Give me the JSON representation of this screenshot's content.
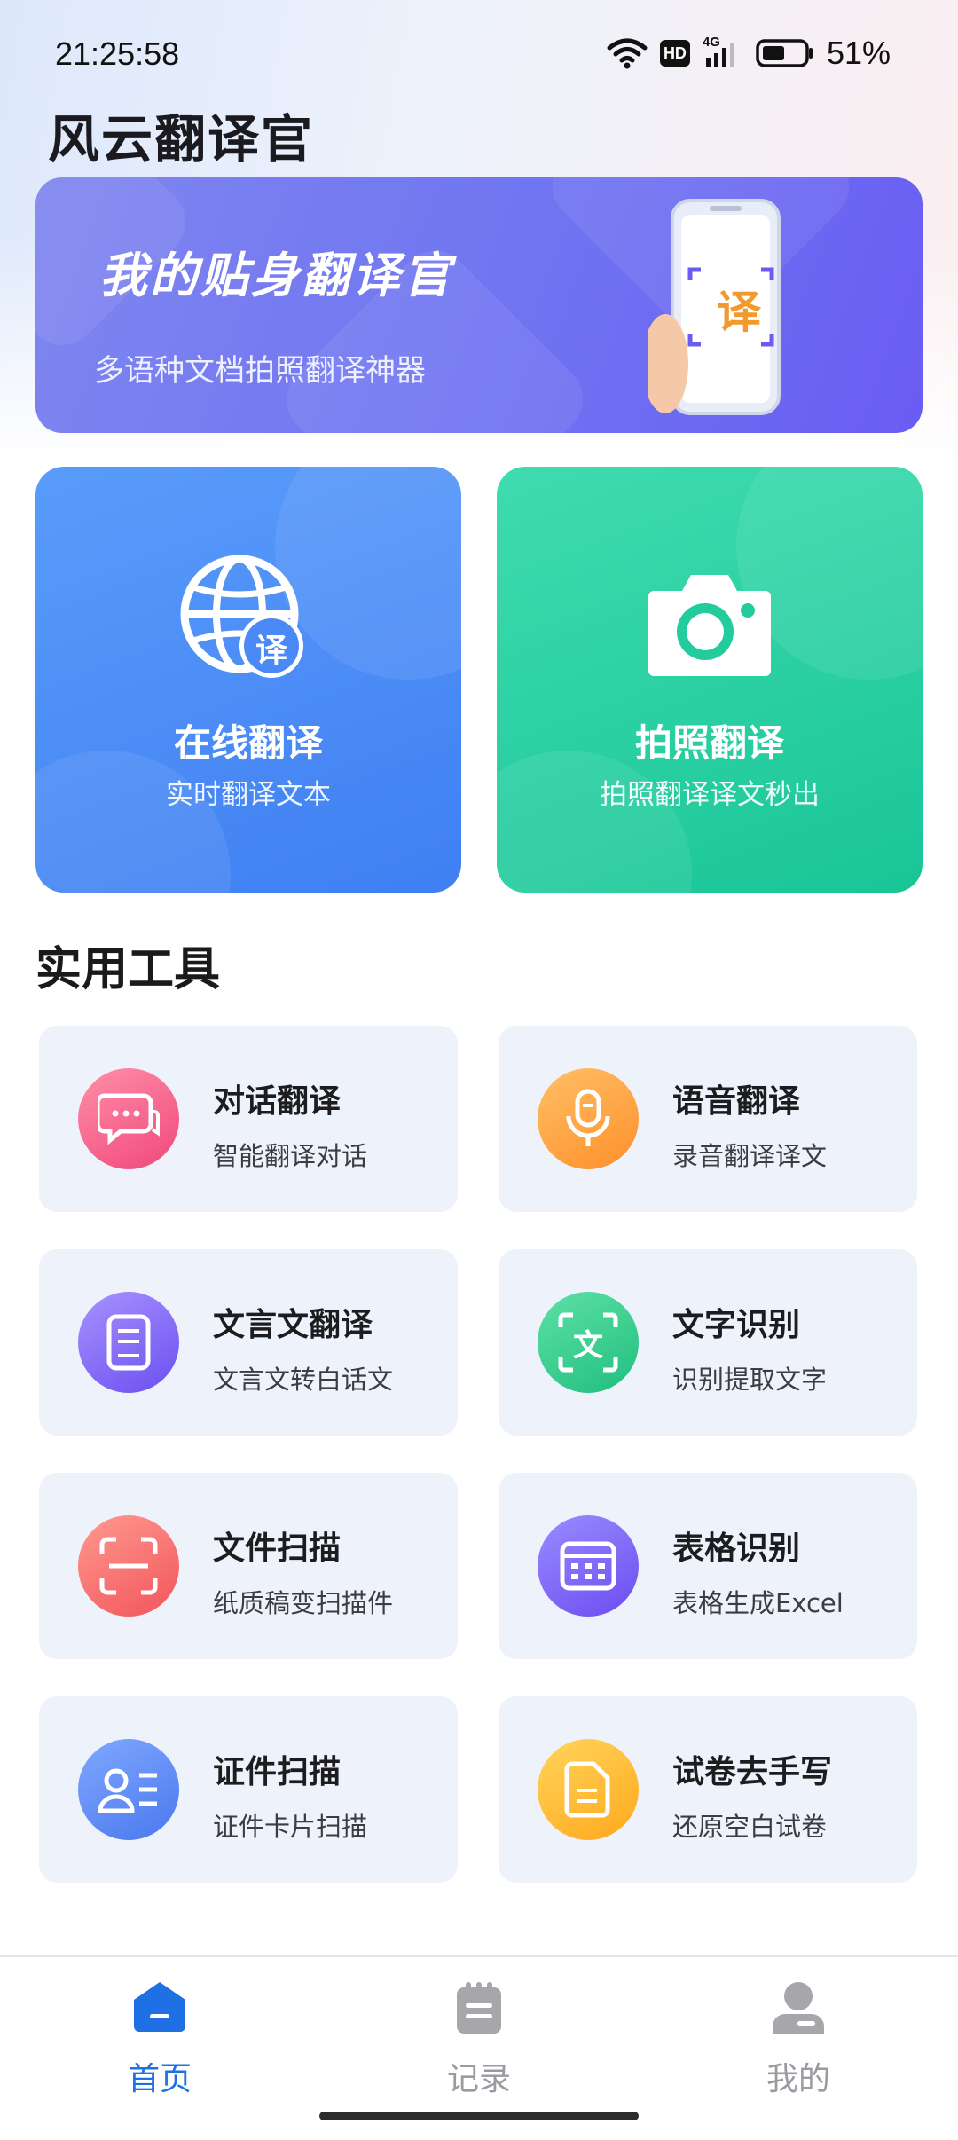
{
  "status_bar": {
    "time": "21:25:58",
    "network": "4G",
    "hd_label": "HD",
    "battery": "51%"
  },
  "app": {
    "title": "风云翻译官"
  },
  "banner": {
    "title": "我的贴身翻译官",
    "subtitle": "多语种文档拍照翻译神器",
    "phone_glyph": "译"
  },
  "feature_cards": [
    {
      "title": "在线翻译",
      "subtitle": "实时翻译文本",
      "icon": "globe-translate-icon",
      "badge": "译",
      "color": "#4a89f6"
    },
    {
      "title": "拍照翻译",
      "subtitle": "拍照翻译译文秒出",
      "icon": "camera-icon",
      "color": "#22cc9c"
    }
  ],
  "tools_section": {
    "title": "实用工具",
    "items": [
      {
        "name": "对话翻译",
        "desc": "智能翻译对话",
        "icon": "chat-bubble-icon"
      },
      {
        "name": "语音翻译",
        "desc": "录音翻译译文",
        "icon": "microphone-icon"
      },
      {
        "name": "文言文翻译",
        "desc": "文言文转白话文",
        "icon": "book-icon"
      },
      {
        "name": "文字识别",
        "desc": "识别提取文字",
        "icon": "text-scan-icon",
        "glyph": "文"
      },
      {
        "name": "文件扫描",
        "desc": "纸质稿变扫描件",
        "icon": "document-scan-icon"
      },
      {
        "name": "表格识别",
        "desc": "表格生成Excel",
        "icon": "table-icon"
      },
      {
        "name": "证件扫描",
        "desc": "证件卡片扫描",
        "icon": "id-card-icon"
      },
      {
        "name": "试卷去手写",
        "desc": "还原空白试卷",
        "icon": "exam-paper-icon"
      }
    ]
  },
  "tabbar": {
    "active_color": "#1f6fe5",
    "inactive_color": "#9a9aa0",
    "tabs": [
      {
        "label": "首页",
        "icon": "home-icon",
        "active": true
      },
      {
        "label": "记录",
        "icon": "notepad-icon",
        "active": false
      },
      {
        "label": "我的",
        "icon": "user-icon",
        "active": false
      }
    ]
  }
}
